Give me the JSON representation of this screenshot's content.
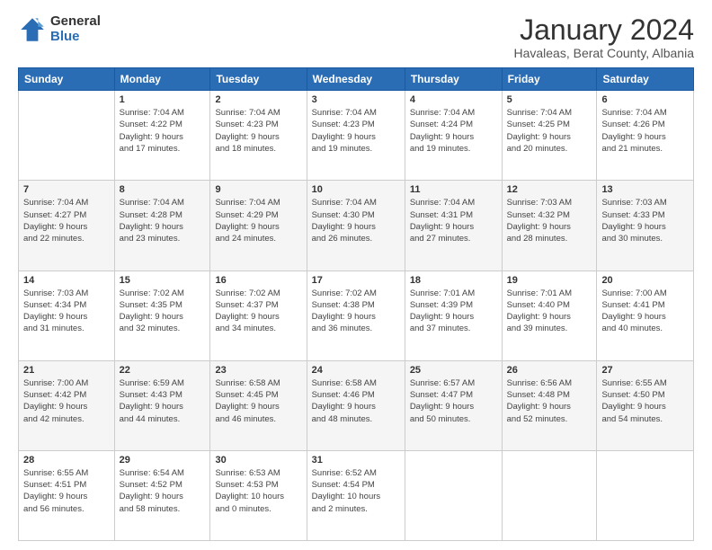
{
  "logo": {
    "general": "General",
    "blue": "Blue"
  },
  "header": {
    "month": "January 2024",
    "location": "Havaleas, Berat County, Albania"
  },
  "days_of_week": [
    "Sunday",
    "Monday",
    "Tuesday",
    "Wednesday",
    "Thursday",
    "Friday",
    "Saturday"
  ],
  "weeks": [
    [
      {
        "day": "",
        "info": ""
      },
      {
        "day": "1",
        "info": "Sunrise: 7:04 AM\nSunset: 4:22 PM\nDaylight: 9 hours\nand 17 minutes."
      },
      {
        "day": "2",
        "info": "Sunrise: 7:04 AM\nSunset: 4:23 PM\nDaylight: 9 hours\nand 18 minutes."
      },
      {
        "day": "3",
        "info": "Sunrise: 7:04 AM\nSunset: 4:23 PM\nDaylight: 9 hours\nand 19 minutes."
      },
      {
        "day": "4",
        "info": "Sunrise: 7:04 AM\nSunset: 4:24 PM\nDaylight: 9 hours\nand 19 minutes."
      },
      {
        "day": "5",
        "info": "Sunrise: 7:04 AM\nSunset: 4:25 PM\nDaylight: 9 hours\nand 20 minutes."
      },
      {
        "day": "6",
        "info": "Sunrise: 7:04 AM\nSunset: 4:26 PM\nDaylight: 9 hours\nand 21 minutes."
      }
    ],
    [
      {
        "day": "7",
        "info": "Sunrise: 7:04 AM\nSunset: 4:27 PM\nDaylight: 9 hours\nand 22 minutes."
      },
      {
        "day": "8",
        "info": "Sunrise: 7:04 AM\nSunset: 4:28 PM\nDaylight: 9 hours\nand 23 minutes."
      },
      {
        "day": "9",
        "info": "Sunrise: 7:04 AM\nSunset: 4:29 PM\nDaylight: 9 hours\nand 24 minutes."
      },
      {
        "day": "10",
        "info": "Sunrise: 7:04 AM\nSunset: 4:30 PM\nDaylight: 9 hours\nand 26 minutes."
      },
      {
        "day": "11",
        "info": "Sunrise: 7:04 AM\nSunset: 4:31 PM\nDaylight: 9 hours\nand 27 minutes."
      },
      {
        "day": "12",
        "info": "Sunrise: 7:03 AM\nSunset: 4:32 PM\nDaylight: 9 hours\nand 28 minutes."
      },
      {
        "day": "13",
        "info": "Sunrise: 7:03 AM\nSunset: 4:33 PM\nDaylight: 9 hours\nand 30 minutes."
      }
    ],
    [
      {
        "day": "14",
        "info": "Sunrise: 7:03 AM\nSunset: 4:34 PM\nDaylight: 9 hours\nand 31 minutes."
      },
      {
        "day": "15",
        "info": "Sunrise: 7:02 AM\nSunset: 4:35 PM\nDaylight: 9 hours\nand 32 minutes."
      },
      {
        "day": "16",
        "info": "Sunrise: 7:02 AM\nSunset: 4:37 PM\nDaylight: 9 hours\nand 34 minutes."
      },
      {
        "day": "17",
        "info": "Sunrise: 7:02 AM\nSunset: 4:38 PM\nDaylight: 9 hours\nand 36 minutes."
      },
      {
        "day": "18",
        "info": "Sunrise: 7:01 AM\nSunset: 4:39 PM\nDaylight: 9 hours\nand 37 minutes."
      },
      {
        "day": "19",
        "info": "Sunrise: 7:01 AM\nSunset: 4:40 PM\nDaylight: 9 hours\nand 39 minutes."
      },
      {
        "day": "20",
        "info": "Sunrise: 7:00 AM\nSunset: 4:41 PM\nDaylight: 9 hours\nand 40 minutes."
      }
    ],
    [
      {
        "day": "21",
        "info": "Sunrise: 7:00 AM\nSunset: 4:42 PM\nDaylight: 9 hours\nand 42 minutes."
      },
      {
        "day": "22",
        "info": "Sunrise: 6:59 AM\nSunset: 4:43 PM\nDaylight: 9 hours\nand 44 minutes."
      },
      {
        "day": "23",
        "info": "Sunrise: 6:58 AM\nSunset: 4:45 PM\nDaylight: 9 hours\nand 46 minutes."
      },
      {
        "day": "24",
        "info": "Sunrise: 6:58 AM\nSunset: 4:46 PM\nDaylight: 9 hours\nand 48 minutes."
      },
      {
        "day": "25",
        "info": "Sunrise: 6:57 AM\nSunset: 4:47 PM\nDaylight: 9 hours\nand 50 minutes."
      },
      {
        "day": "26",
        "info": "Sunrise: 6:56 AM\nSunset: 4:48 PM\nDaylight: 9 hours\nand 52 minutes."
      },
      {
        "day": "27",
        "info": "Sunrise: 6:55 AM\nSunset: 4:50 PM\nDaylight: 9 hours\nand 54 minutes."
      }
    ],
    [
      {
        "day": "28",
        "info": "Sunrise: 6:55 AM\nSunset: 4:51 PM\nDaylight: 9 hours\nand 56 minutes."
      },
      {
        "day": "29",
        "info": "Sunrise: 6:54 AM\nSunset: 4:52 PM\nDaylight: 9 hours\nand 58 minutes."
      },
      {
        "day": "30",
        "info": "Sunrise: 6:53 AM\nSunset: 4:53 PM\nDaylight: 10 hours\nand 0 minutes."
      },
      {
        "day": "31",
        "info": "Sunrise: 6:52 AM\nSunset: 4:54 PM\nDaylight: 10 hours\nand 2 minutes."
      },
      {
        "day": "",
        "info": ""
      },
      {
        "day": "",
        "info": ""
      },
      {
        "day": "",
        "info": ""
      }
    ]
  ]
}
